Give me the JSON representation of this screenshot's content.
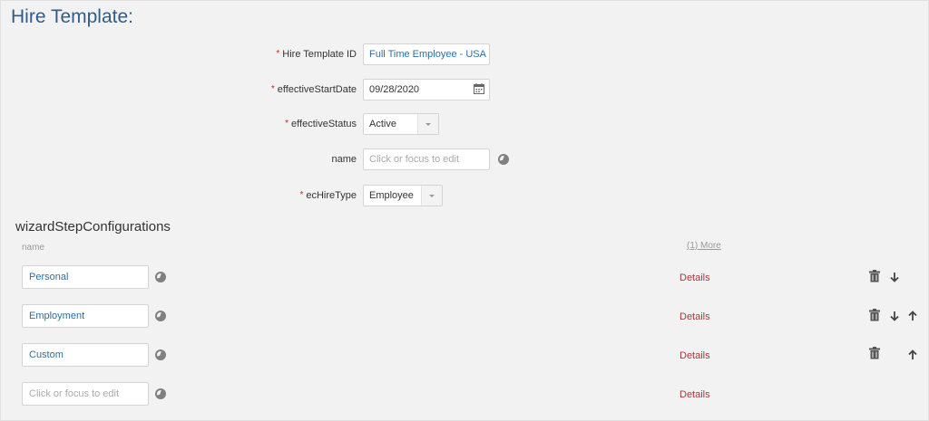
{
  "page": {
    "title": "Hire Template:"
  },
  "form": {
    "hire_template_id": {
      "label": "Hire Template ID",
      "value": "Full Time Employee - USA"
    },
    "effective_start_date": {
      "label": "effectiveStartDate",
      "value": "09/28/2020"
    },
    "effective_status": {
      "label": "effectiveStatus",
      "value": "Active"
    },
    "name": {
      "label": "name",
      "placeholder": "Click or focus to edit"
    },
    "ec_hire_type": {
      "label": "ecHireType",
      "value": "Employee"
    },
    "required_marker": "*"
  },
  "wizard": {
    "title": "wizardStepConfigurations",
    "column_name": "name",
    "more_link": "(1) More",
    "rows": [
      {
        "name": "Personal",
        "details": "Details"
      },
      {
        "name": "Employment",
        "details": "Details"
      },
      {
        "name": "Custom",
        "details": "Details"
      },
      {
        "placeholder": "Click or focus to edit",
        "details": "Details"
      }
    ]
  },
  "icons": {
    "date_picker": "calendar-icon",
    "translation": "globe-icon",
    "delete": "trash-icon",
    "move_down": "arrow-down-icon",
    "move_up": "arrow-up-icon"
  },
  "colors": {
    "title": "#2f5d86",
    "link": "#2e6da4",
    "required": "#d0271d",
    "details": "#a33a3a"
  }
}
